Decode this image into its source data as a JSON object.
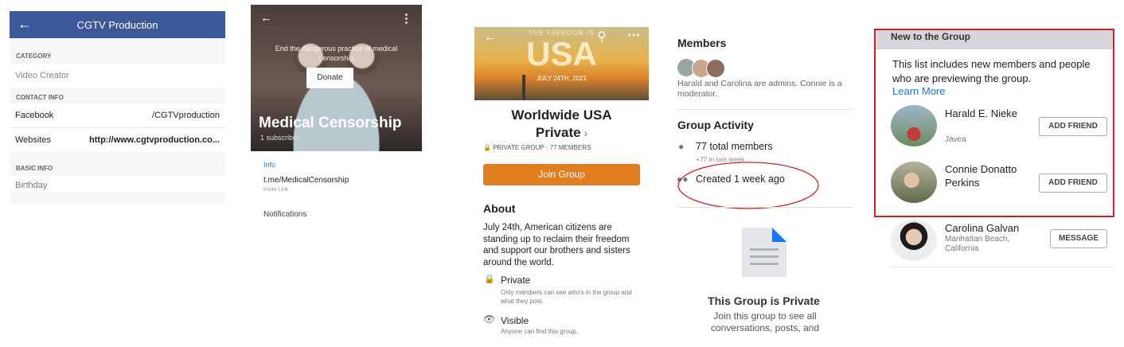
{
  "panel1": {
    "title": "CGTV Production",
    "category_header": "CATEGORY",
    "category_value": "Video Creator",
    "contact_header": "CONTACT INFO",
    "facebook_label": "Facebook",
    "facebook_value": "/CGTVproduction",
    "websites_label": "Websites",
    "websites_value": "http://www.cgtvproduction.co...",
    "basic_header": "BASIC INFO",
    "cutoff_text": "Birthday"
  },
  "panel2": {
    "overlay_text": "End the dangerous practice of medical censorship",
    "donate_label": "Donate",
    "channel_name": "Medical Censorship",
    "subscribers": "1 subscriber",
    "info_header": "Info",
    "link": "t.me/MedicalCensorship",
    "link_caption": "Invite Link",
    "notifications": "Notifications"
  },
  "panel3": {
    "banner_top": "THE FREEDOM IS",
    "banner_big": "USA",
    "banner_date": "JULY 24TH, 2021",
    "group_name_1": "Worldwide USA",
    "group_name_2": "Private",
    "meta": "PRIVATE GROUP · 77 MEMBERS",
    "join_label": "Join Group",
    "about_header": "About",
    "about_text": "July 24th, American citizens are standing up to reclaim their freedom and support our brothers and sisters around the world.",
    "private_title": "Private",
    "private_desc": "Only members can see who's in the group and what they post.",
    "visible_title": "Visible",
    "visible_desc": "Anyone can find this group."
  },
  "panel4": {
    "members_header": "Members",
    "admins_text": "Harald and Carolina are admins. Connie is a moderator.",
    "activity_header": "Group Activity",
    "total_members": "77 total members",
    "last_week": "+77 in last week",
    "created": "Created 1 week ago",
    "private_title": "This Group is Private",
    "private_desc": "Join this group to see all conversations, posts, and"
  },
  "panel5": {
    "header": "New to the Group",
    "intro": "This list includes new members and people who are previewing the group.",
    "learn_more": "Learn More",
    "members": [
      {
        "name": "Harald E. Nieke",
        "location": "Jávea",
        "action": "ADD FRIEND"
      },
      {
        "name": "Connie Donatto Perkins",
        "location": "",
        "action": "ADD FRIEND"
      },
      {
        "name": "Carolina Galvan",
        "location": "Manhattan Beach, California",
        "action": "MESSAGE"
      }
    ],
    "highlight_color": "#d0202a"
  },
  "colors": {
    "facebook_blue": "#3b5998",
    "join_orange": "#e07d1f",
    "telegram_blue": "#2f7dc1",
    "link_blue": "#1877f2"
  }
}
